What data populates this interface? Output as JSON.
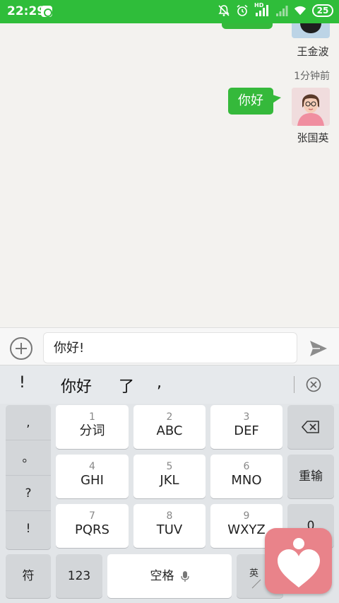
{
  "status_bar": {
    "time": "22:29",
    "signal_label": "HD",
    "battery": "25",
    "bg_color": "#2fbd3a"
  },
  "chat": {
    "messages": [
      {
        "sender": "王金波",
        "side": "right",
        "text": ""
      },
      {
        "sender": "张国英",
        "side": "right",
        "text": "你好",
        "timestamp": "1分钟前"
      }
    ],
    "bubble_color": "#35b93b"
  },
  "input_bar": {
    "value": "你好!",
    "plus_icon": "plus-circle-icon",
    "send_icon": "send-icon"
  },
  "candidates": {
    "items": [
      "!",
      "你好",
      "了",
      ","
    ],
    "delete_icon": "clear-circle-icon"
  },
  "keyboard": {
    "symbols": [
      ",",
      "。",
      "?",
      "!"
    ],
    "rows": [
      [
        {
          "num": "1",
          "label": "分词"
        },
        {
          "num": "2",
          "label": "ABC"
        },
        {
          "num": "3",
          "label": "DEF"
        }
      ],
      [
        {
          "num": "4",
          "label": "GHI"
        },
        {
          "num": "5",
          "label": "JKL"
        },
        {
          "num": "6",
          "label": "MNO"
        }
      ],
      [
        {
          "num": "7",
          "label": "PQRS"
        },
        {
          "num": "8",
          "label": "TUV"
        },
        {
          "num": "9",
          "label": "WXYZ"
        }
      ]
    ],
    "backspace_icon": "backspace-icon",
    "reinput_label": "重输",
    "zero_label": "0",
    "fu_label": "符",
    "num_label": "123",
    "space_label": "空格",
    "lang_label": "英"
  },
  "overlay": {
    "icon": "heart-person-icon",
    "color": "#e9838a"
  }
}
